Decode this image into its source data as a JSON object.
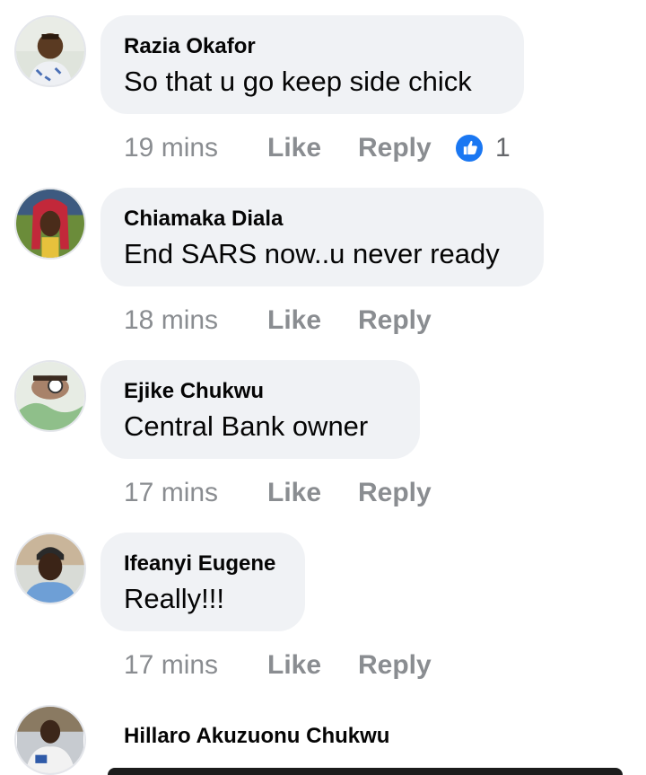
{
  "comments": [
    {
      "name": "Razia Okafor",
      "text": "So that u go keep side chick",
      "time": "19 mins",
      "like_label": "Like",
      "reply_label": "Reply",
      "reactions": {
        "icon": "like-icon",
        "count": "1",
        "color": "#1a77f2"
      }
    },
    {
      "name": "Chiamaka Diala",
      "text": "End SARS now..u never ready",
      "time": "18 mins",
      "like_label": "Like",
      "reply_label": "Reply"
    },
    {
      "name": "Ejike Chukwu",
      "text": "Central Bank owner",
      "time": "17 mins",
      "like_label": "Like",
      "reply_label": "Reply"
    },
    {
      "name": "Ifeanyi Eugene",
      "text": "Really!!!",
      "time": "17 mins",
      "like_label": "Like",
      "reply_label": "Reply"
    },
    {
      "name": "Hillaro Akuzuonu Chukwu"
    }
  ],
  "colors": {
    "bubble_bg": "#f0f2f5",
    "meta_text": "#8a8d91",
    "name_text": "#050505",
    "like_accent": "#1a77f2"
  }
}
